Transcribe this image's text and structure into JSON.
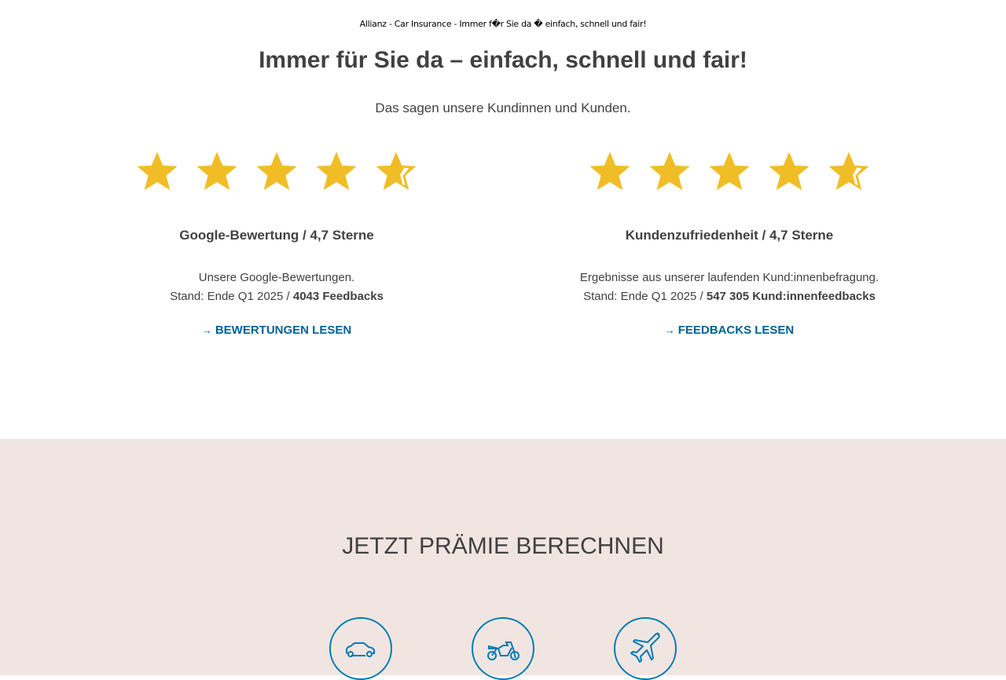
{
  "document_title": "Allianz - Car Insurance - Immer f�r Sie da � einfach, schnell und fair!",
  "heading": "Immer für Sie da – einfach, schnell und fair!",
  "subheading": "Das sagen unsere Kundinnen und Kunden.",
  "colors": {
    "star": "#f0bd27",
    "link": "#006192",
    "band": "#f1e5e1",
    "icon": "#007ab3"
  },
  "ratings": [
    {
      "rating": 4.7,
      "max": 5,
      "title": "Google-Bewertung / 4,7 Sterne",
      "line1": "Unsere Google-Bewertungen.",
      "line2_prefix": "Stand: Ende Q1 2025 / ",
      "line2_bold": "4043 Feedbacks",
      "link": "BEWERTUNGEN LESEN",
      "arrow": "→"
    },
    {
      "rating": 4.7,
      "max": 5,
      "title": "Kundenzufriedenheit / 4,7 Sterne",
      "line1": "Ergebnisse aus unserer laufenden Kund:innenbefragung.",
      "line2_prefix": "Stand: Ende Q1 2025 / ",
      "line2_bold": "547 305 Kund:innenfeedbacks",
      "link": "FEEDBACKS LESEN",
      "arrow": "→"
    }
  ],
  "calculator": {
    "heading": "JETZT PRÄMIE BERECHNEN",
    "products": [
      {
        "icon": "car-icon"
      },
      {
        "icon": "motorcycle-icon"
      },
      {
        "icon": "airplane-icon"
      }
    ]
  }
}
